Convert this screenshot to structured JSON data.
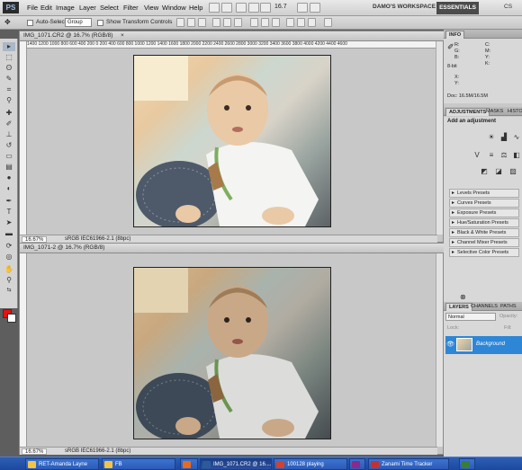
{
  "app": {
    "logo": "PS"
  },
  "menu": [
    "File",
    "Edit",
    "Image",
    "Layer",
    "Select",
    "Filter",
    "View",
    "Window",
    "Help"
  ],
  "zoom_level": "16.7",
  "workspace": "DAMO'S WORKSPACE",
  "essentials": "ESSENTIALS",
  "cslive": "CS",
  "options": {
    "auto_select": "Auto-Select:",
    "group_value": "Group",
    "show_transform": "Show Transform Controls"
  },
  "documents": [
    {
      "title": "IMG_1071.CR2 @ 16.7% (RGB/8)",
      "close": "×",
      "zoom": "16.67%",
      "profile": "sRGB IEC61966-2.1 (8bpc)"
    },
    {
      "title": "IMG_1071-2 @ 16.7% (RGB/8)",
      "close": "",
      "zoom": "16.67%",
      "profile": "sRGB IEC61966-2.1 (8bpc)"
    }
  ],
  "ruler_ticks": "1400  1200  1000  800  600  400  200  0  200  400  600  800  1000  1200  1400  1600  1800  2000  2200  2400  2600  2800  3000  3200  3400  3600  3800  4000  4200  4400  4600",
  "info": {
    "tab": "INFO",
    "r": "R:",
    "g": "G:",
    "b": "B:",
    "bit": "8-bit",
    "c": "C:",
    "m": "M:",
    "y": "Y:",
    "k": "K:",
    "x": "X:",
    "yy": "Y:",
    "doc": "Doc: 16.5M/16.5M"
  },
  "adjust": {
    "tabs": [
      "ADJUSTMENTS",
      "MASKS",
      "HISTO"
    ],
    "heading": "Add an adjustment",
    "presets": [
      "Levels Presets",
      "Curves Presets",
      "Exposure Presets",
      "Hue/Saturation Presets",
      "Black & White Presets",
      "Channel Mixer Presets",
      "Selective Color Presets"
    ]
  },
  "layers": {
    "tabs": [
      "LAYERS",
      "CHANNELS",
      "PATHS"
    ],
    "blend": "Normal",
    "opacity_label": "Opacity:",
    "lock_label": "Lock:",
    "fill_label": "Fill:",
    "layer_name": "Background"
  },
  "taskbar": [
    {
      "label": "RET-Amanda Layne"
    },
    {
      "label": "FB"
    },
    {
      "label": "IMG_1071.CR2 @ 16...."
    },
    {
      "label": "100128 playing"
    },
    {
      "label": "Zanami Time Tracker"
    }
  ],
  "colors": {
    "foreground": "#e81010",
    "background": "#ffffff",
    "layer_selected": "#2e86d6"
  }
}
